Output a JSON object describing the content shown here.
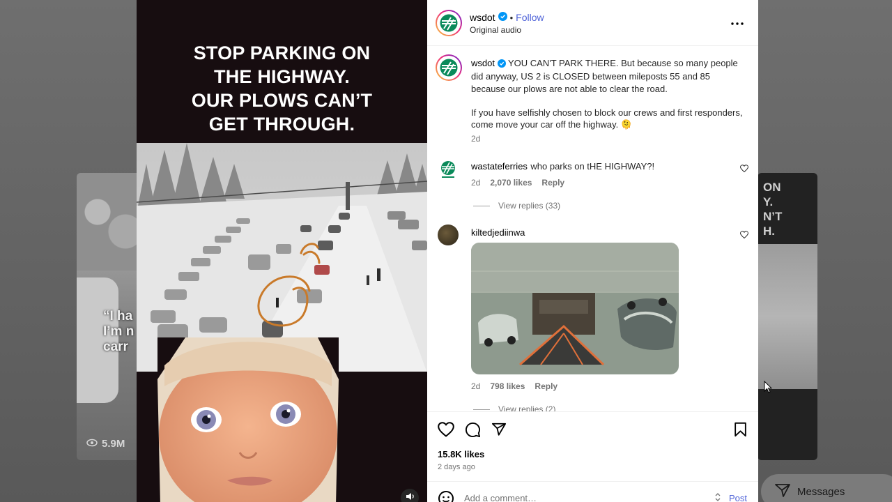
{
  "background": {
    "left_quote": "“I ha\nI’m n\ncarr",
    "left_views": "5.9M",
    "right_text": "ON\nY.\nN’T\nH.",
    "messages_label": "Messages"
  },
  "media": {
    "headline": "STOP PARKING ON\nTHE HIGHWAY.\nOUR PLOWS CAN’T\nGET THROUGH."
  },
  "post": {
    "username": "wsdot",
    "follow_label": "Follow",
    "audio_label": "Original audio",
    "caption_text_1": "YOU CAN'T PARK THERE. But because so many people did anyway, US 2 is CLOSED between mileposts 55 and 85 because our plows are not able to clear the road.",
    "caption_text_2": "If you have selfishly chosen to block our crews and first responders, come move your car off the highway. 🫠",
    "caption_time": "2d",
    "comments": [
      {
        "username": "wastateferries",
        "text": "who parks on tHE HIGHWAY?!",
        "time": "2d",
        "likes": "2,070 likes",
        "reply_label": "Reply",
        "view_replies": "View replies (33)"
      },
      {
        "username": "kiltedjediinwa",
        "text": "",
        "time": "2d",
        "likes": "798 likes",
        "reply_label": "Reply",
        "view_replies": "View replies (2)"
      }
    ],
    "likes_total": "15.8K likes",
    "time_ago": "2 days ago",
    "comment_placeholder": "Add a comment…",
    "post_label": "Post"
  },
  "colors": {
    "accent_blue": "#4f63d8",
    "wsdot_green": "#0a8a5a",
    "verified_blue": "#0095f6"
  }
}
